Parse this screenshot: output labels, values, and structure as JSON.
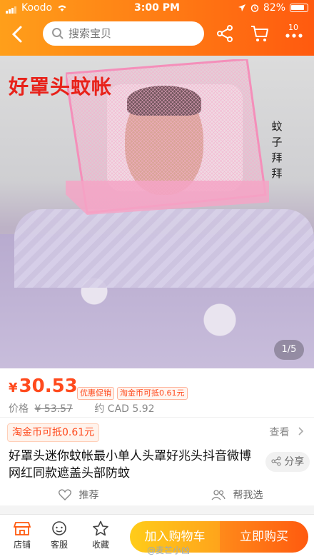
{
  "status_bar": {
    "carrier": "Koodo",
    "time": "3:00 PM",
    "battery": "82%"
  },
  "header": {
    "search_placeholder": "搜索宝贝",
    "more_badge": "10"
  },
  "hero": {
    "overlay_title": "好罩头蚊帐",
    "overlay_vertical": [
      "蚊",
      "子",
      "拜",
      "拜"
    ],
    "pager": "1/5"
  },
  "pricing": {
    "currency": "¥",
    "price": "30.53",
    "tags": [
      "优惠促销",
      "淘金币可抵0.61元"
    ],
    "orig_label": "价格",
    "orig_price": "¥ 53.57",
    "cad": "约 CAD 5.92"
  },
  "promo": {
    "coin_label": "淘金币可抵0.61元",
    "see_more": "查看"
  },
  "product": {
    "title": "好罩头迷你蚊帐最小单人头罩好兆头抖音微博网红同款遮盖头部防蚊",
    "share": "分享",
    "recommend": "推荐",
    "help_choose": "帮我选"
  },
  "bottom_bar": {
    "tabs": [
      "店铺",
      "客服",
      "收藏"
    ],
    "add_to_cart": "加入购物车",
    "buy_now": "立即购买"
  },
  "watermark": "@麦芒小凶",
  "colors": {
    "accent": "#ff5a0f",
    "price": "#ff4a1d"
  }
}
